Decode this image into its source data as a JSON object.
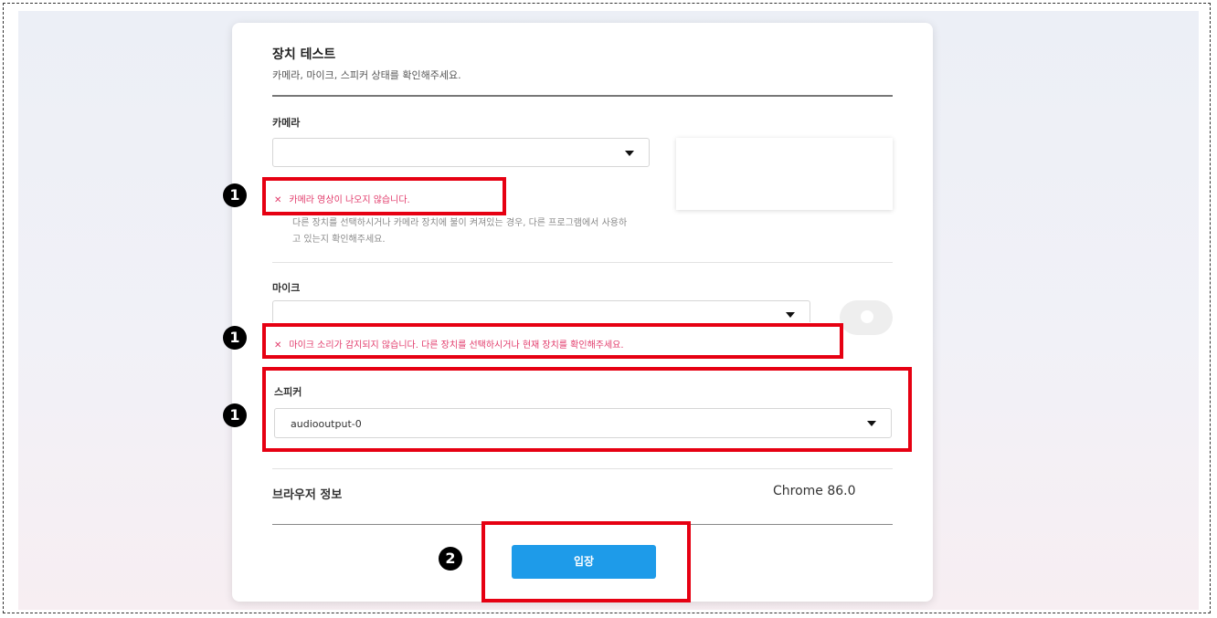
{
  "test": {
    "title": "장치 테스트",
    "subtitle": "카메라, 마이크, 스피커 상태를 확인해주세요."
  },
  "camera": {
    "label": "카메라",
    "selected": "",
    "error": "카메라 영상이 나오지 않습니다.",
    "help_line1": "다른 장치를 선택하시거나 카메라 장치에 불이 켜져있는 경우, 다른 프로그램에서 사용하",
    "help_line2": "고 있는지 확인해주세요."
  },
  "mic": {
    "label": "마이크",
    "selected": "",
    "error": "마이크 소리가 감지되지 않습니다. 다른 장치를 선택하시거나 현재 장치를 확인해주세요."
  },
  "speaker": {
    "label": "스피커",
    "selected": "audiooutput-0"
  },
  "browser": {
    "label": "브라우저 정보",
    "value": "Chrome 86.0"
  },
  "enter_button": "입장",
  "badges": {
    "one": "1",
    "two": "2"
  },
  "colors": {
    "accent": "#1e9be9",
    "error_text": "#e23b6b",
    "highlight": "#e60012"
  },
  "icons": {
    "error": "x-icon",
    "dropdown": "caret-down-icon",
    "mic_level": "mic-level-icon"
  }
}
